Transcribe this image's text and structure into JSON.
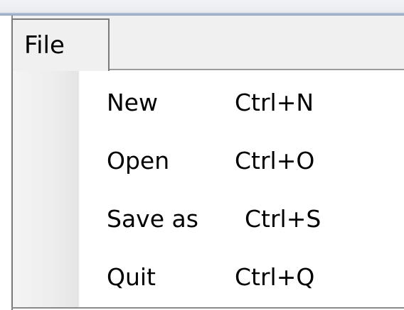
{
  "menubar": {
    "file_label": "File"
  },
  "menu": {
    "items": [
      {
        "label": "New",
        "shortcut": "Ctrl+N"
      },
      {
        "label": "Open",
        "shortcut": "Ctrl+O"
      },
      {
        "label": "Save as",
        "shortcut": "Ctrl+S"
      },
      {
        "label": "Quit",
        "shortcut": "Ctrl+Q"
      }
    ]
  },
  "colors": {
    "menubar_bg": "#f0f0f0",
    "menu_bg": "#ffffff",
    "border": "#7a7a7a",
    "text": "#000000"
  }
}
